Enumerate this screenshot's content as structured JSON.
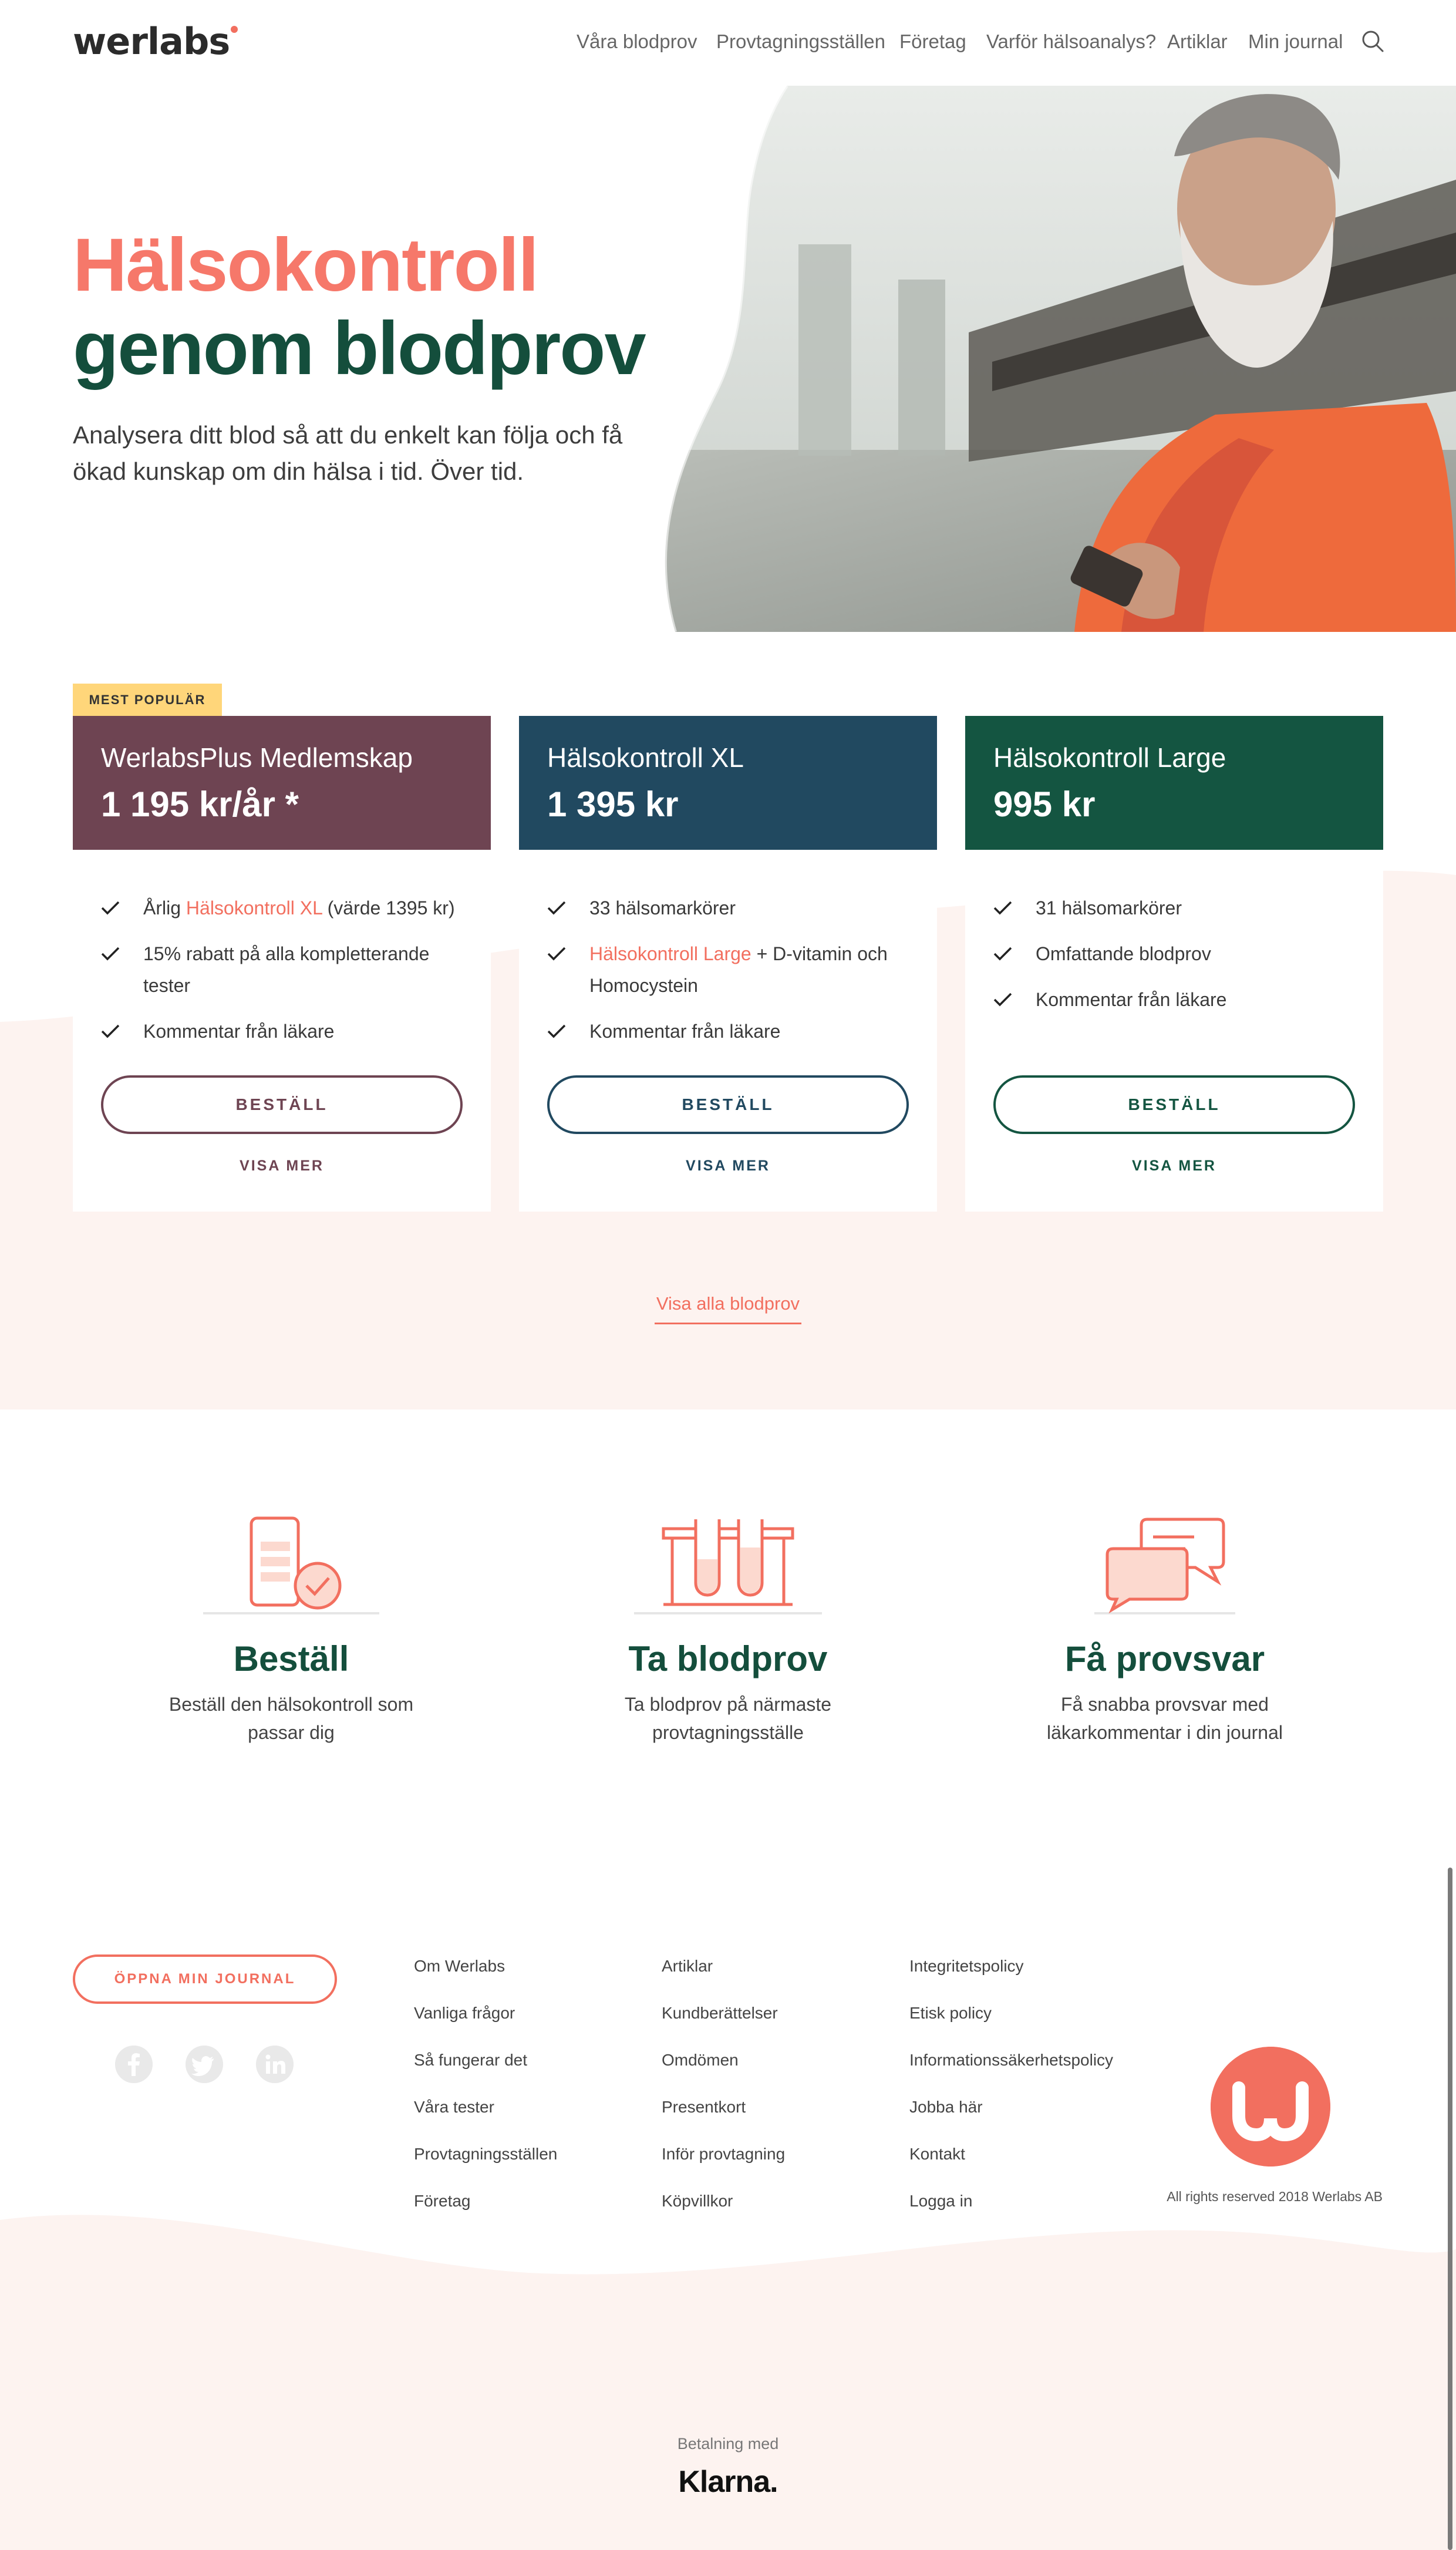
{
  "header": {
    "logo": "werlabs",
    "nav": [
      "Våra blodprov",
      "Provtagningsställen",
      "Företag",
      "Varför hälsoanalys?",
      "Artiklar",
      "Min journal"
    ]
  },
  "hero": {
    "title_line1": "Hälsokontroll",
    "title_line2": "genom blodprov",
    "subtitle": "Analysera ditt blod så att du enkelt kan följa och få ökad kunskap om din hälsa i tid. Över tid."
  },
  "pricing": {
    "badge": "MEST POPULÄR",
    "cards": [
      {
        "name": "WerlabsPlus Medlemskap",
        "price": "1 195 kr/år *",
        "color": "#6e4452",
        "features": [
          {
            "pre": "Årlig ",
            "highlight": "Hälsokontroll XL",
            "post": " (värde 1395 kr)"
          },
          {
            "pre": "15% rabatt på alla kompletterande tester",
            "highlight": "",
            "post": ""
          },
          {
            "pre": "Kommentar från läkare",
            "highlight": "",
            "post": ""
          }
        ],
        "order": "BESTÄLL",
        "more": "VISA MER"
      },
      {
        "name": "Hälsokontroll XL",
        "price": "1 395 kr",
        "color": "#214960",
        "features": [
          {
            "pre": "33 hälsomarkörer",
            "highlight": "",
            "post": ""
          },
          {
            "pre": "",
            "highlight": "Hälsokontroll Large",
            "post": " + D-vitamin och Homocystein"
          },
          {
            "pre": "Kommentar från läkare",
            "highlight": "",
            "post": ""
          }
        ],
        "order": "BESTÄLL",
        "more": "VISA MER"
      },
      {
        "name": "Hälsokontroll Large",
        "price": "995 kr",
        "color": "#145541",
        "features": [
          {
            "pre": "31 hälsomarkörer",
            "highlight": "",
            "post": ""
          },
          {
            "pre": "Omfattande blodprov",
            "highlight": "",
            "post": ""
          },
          {
            "pre": "Kommentar från läkare",
            "highlight": "",
            "post": ""
          }
        ],
        "order": "BESTÄLL",
        "more": "VISA MER"
      }
    ],
    "all_link": "Visa alla blodprov"
  },
  "steps": [
    {
      "icon": "phone-check-icon",
      "title": "Beställ",
      "desc": "Beställ den hälsokontroll som passar dig"
    },
    {
      "icon": "test-tubes-icon",
      "title": "Ta blodprov",
      "desc": "Ta blodprov på närmaste provtagningsställe"
    },
    {
      "icon": "chat-bubbles-icon",
      "title": "Få provsvar",
      "desc": "Få snabba provsvar med läkarkommentar i din journal"
    }
  ],
  "footer": {
    "journal_button": "ÖPPNA MIN JOURNAL",
    "social": [
      "facebook-icon",
      "twitter-icon",
      "linkedin-icon"
    ],
    "col1": [
      "Om Werlabs",
      "Vanliga frågor",
      "Så fungerar det",
      "Våra tester",
      "Provtagningsställen",
      "Företag"
    ],
    "col2": [
      "Artiklar",
      "Kundberättelser",
      "Omdömen",
      "Presentkort",
      "Inför provtagning",
      "Köpvillkor"
    ],
    "col3": [
      "Integritetspolicy",
      "Etisk policy",
      "Informationssäkerhetspolicy",
      "Jobba här",
      "Kontakt",
      "Logga in"
    ],
    "rights": "All rights reserved 2018 Werlabs AB",
    "payment_label": "Betalning med",
    "payment_brand": "Klarna."
  },
  "colors": {
    "accent": "#f26f5f",
    "dark_green": "#144e3c",
    "pink_bg": "#fdf3f0"
  }
}
